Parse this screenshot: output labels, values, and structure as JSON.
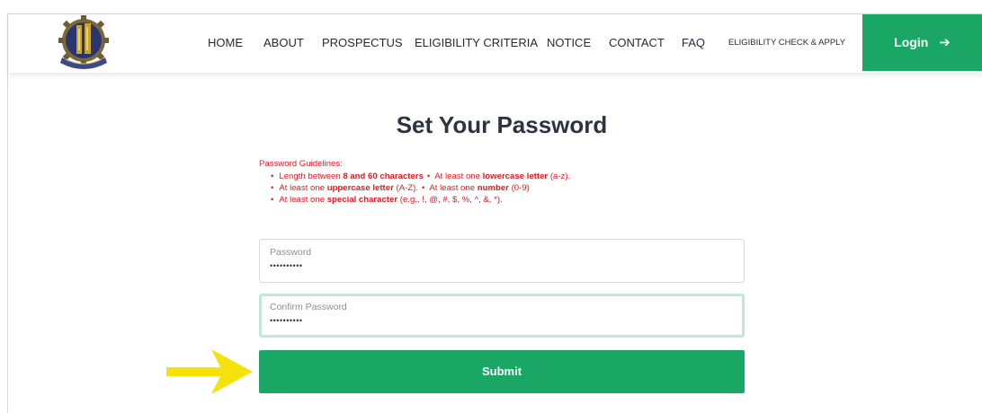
{
  "nav": {
    "items": [
      "HOME",
      "ABOUT",
      "PROSPECTUS",
      "ELIGIBILITY CRITERIA",
      "NOTICE",
      "CONTACT",
      "FAQ",
      "ELIGIBILITY CHECK & APPLY"
    ],
    "login_label": "Login",
    "login_icon": "arrow-right-icon"
  },
  "page": {
    "title": "Set Your Password"
  },
  "guidelines": {
    "heading": "Password Guidelines:",
    "line1": {
      "a": "Length between ",
      "b": "8 and 60 characters",
      "sep": "•",
      "c": "At least one ",
      "d": "lowercase letter",
      "e": " (a-z)."
    },
    "line2": {
      "a": "At least one ",
      "b": "uppercase letter",
      "c": " (A-Z).",
      "sep": "•",
      "d": "At least one ",
      "e": "number",
      "f": " (0-9)"
    },
    "line3": {
      "a": "At least one ",
      "b": "special character",
      "c": " (e.g., !, @, #, $, %, ^, &, *)."
    }
  },
  "form": {
    "password_label": "Password",
    "password_value": "••••••••••",
    "confirm_label": "Confirm Password",
    "confirm_value": "••••••••••",
    "submit_label": "Submit"
  },
  "colors": {
    "accent_green": "#1aa765",
    "guideline_red": "#e8191e",
    "pointer_yellow": "#f5e20c"
  }
}
